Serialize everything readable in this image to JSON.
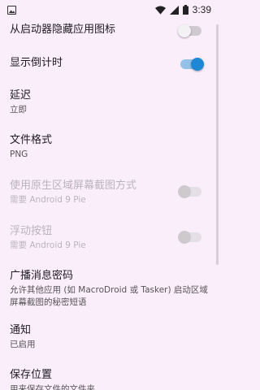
{
  "status_bar": {
    "time": "3:39",
    "icons": [
      "image-icon",
      "wifi-icon",
      "signal-icon",
      "battery-icon"
    ]
  },
  "settings": [
    {
      "title": "从启动器隐藏应用图标",
      "toggle": "off"
    },
    {
      "title": "显示倒计时",
      "toggle": "on"
    },
    {
      "title": "延迟",
      "summary": "立即"
    },
    {
      "title": "文件格式",
      "summary": "PNG"
    },
    {
      "title": "使用原生区域屏幕截图方式",
      "summary": "需要 Android 9 Pie",
      "toggle": "disabled"
    },
    {
      "title": "浮动按钮",
      "summary": "需要 Android 9 Pie",
      "toggle": "disabled"
    },
    {
      "title": "广播消息密码",
      "summary": "允许其他应用 (如 MacroDroid 或 Tasker) 启动区域屏幕截图的秘密短语"
    },
    {
      "title": "通知",
      "summary": "已启用"
    },
    {
      "title": "保存位置",
      "summary": "用来保存文件的文件夹"
    }
  ],
  "colors": {
    "background": "#fbeefb",
    "accent": "#1e88d4"
  }
}
